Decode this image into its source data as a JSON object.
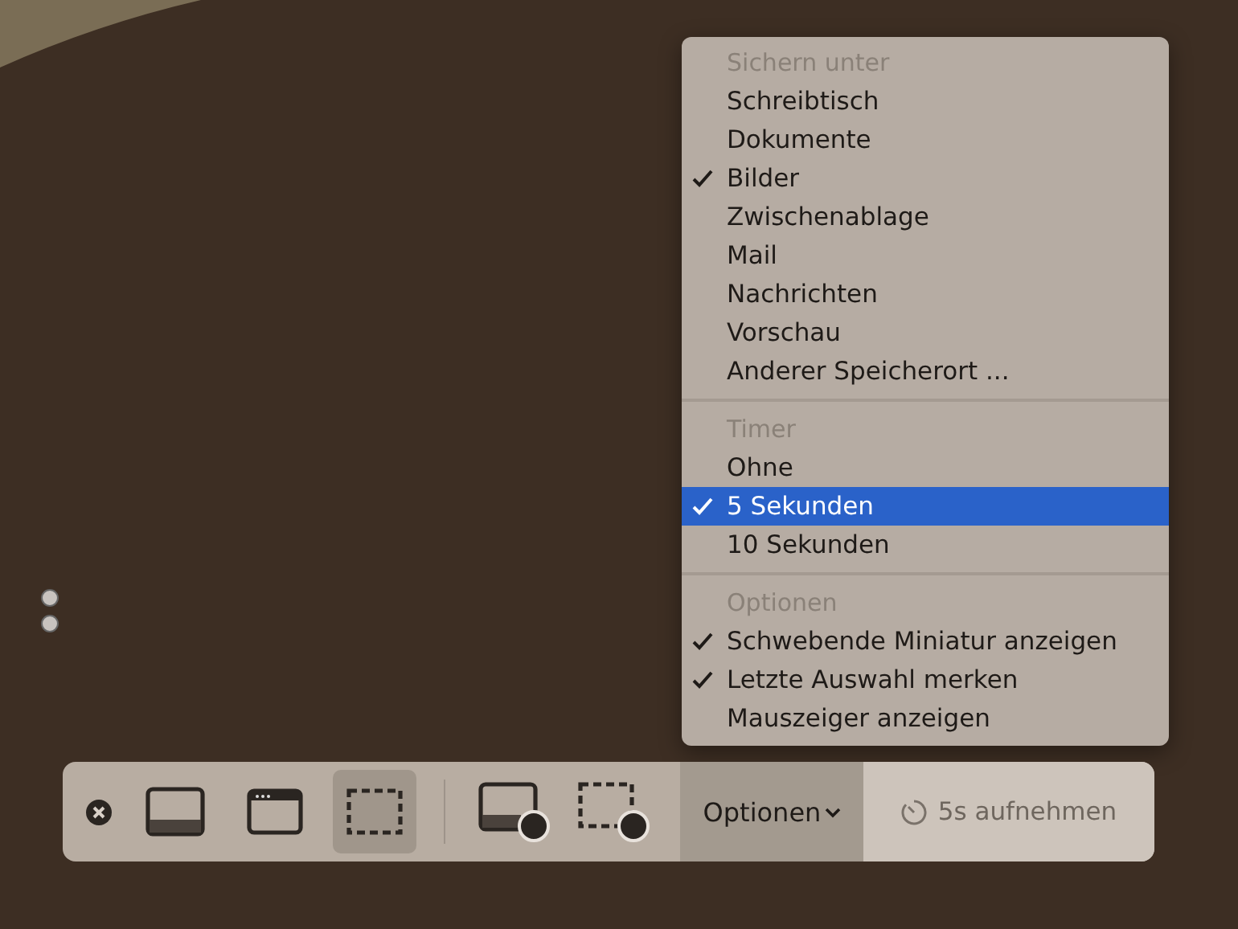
{
  "menu": {
    "sections": [
      {
        "header": "Sichern unter",
        "items": [
          {
            "label": "Schreibtisch",
            "checked": false,
            "selected": false
          },
          {
            "label": "Dokumente",
            "checked": false,
            "selected": false
          },
          {
            "label": "Bilder",
            "checked": true,
            "selected": false
          },
          {
            "label": "Zwischenablage",
            "checked": false,
            "selected": false
          },
          {
            "label": "Mail",
            "checked": false,
            "selected": false
          },
          {
            "label": "Nachrichten",
            "checked": false,
            "selected": false
          },
          {
            "label": "Vorschau",
            "checked": false,
            "selected": false
          },
          {
            "label": "Anderer Speicherort ...",
            "checked": false,
            "selected": false
          }
        ]
      },
      {
        "header": "Timer",
        "items": [
          {
            "label": "Ohne",
            "checked": false,
            "selected": false
          },
          {
            "label": "5 Sekunden",
            "checked": true,
            "selected": true
          },
          {
            "label": "10 Sekunden",
            "checked": false,
            "selected": false
          }
        ]
      },
      {
        "header": "Optionen",
        "items": [
          {
            "label": "Schwebende Miniatur anzeigen",
            "checked": true,
            "selected": false
          },
          {
            "label": "Letzte Auswahl merken",
            "checked": true,
            "selected": false
          },
          {
            "label": "Mauszeiger anzeigen",
            "checked": false,
            "selected": false
          }
        ]
      }
    ]
  },
  "toolbar": {
    "tools": [
      {
        "kind": "screen",
        "selected": false
      },
      {
        "kind": "window",
        "selected": false
      },
      {
        "kind": "selection",
        "selected": true
      },
      {
        "kind": "record-screen",
        "selected": false
      },
      {
        "kind": "record-selection",
        "selected": false
      }
    ],
    "options_button": {
      "label": "Optionen",
      "open": true
    },
    "capture_button": {
      "label": "5s aufnehmen"
    }
  }
}
